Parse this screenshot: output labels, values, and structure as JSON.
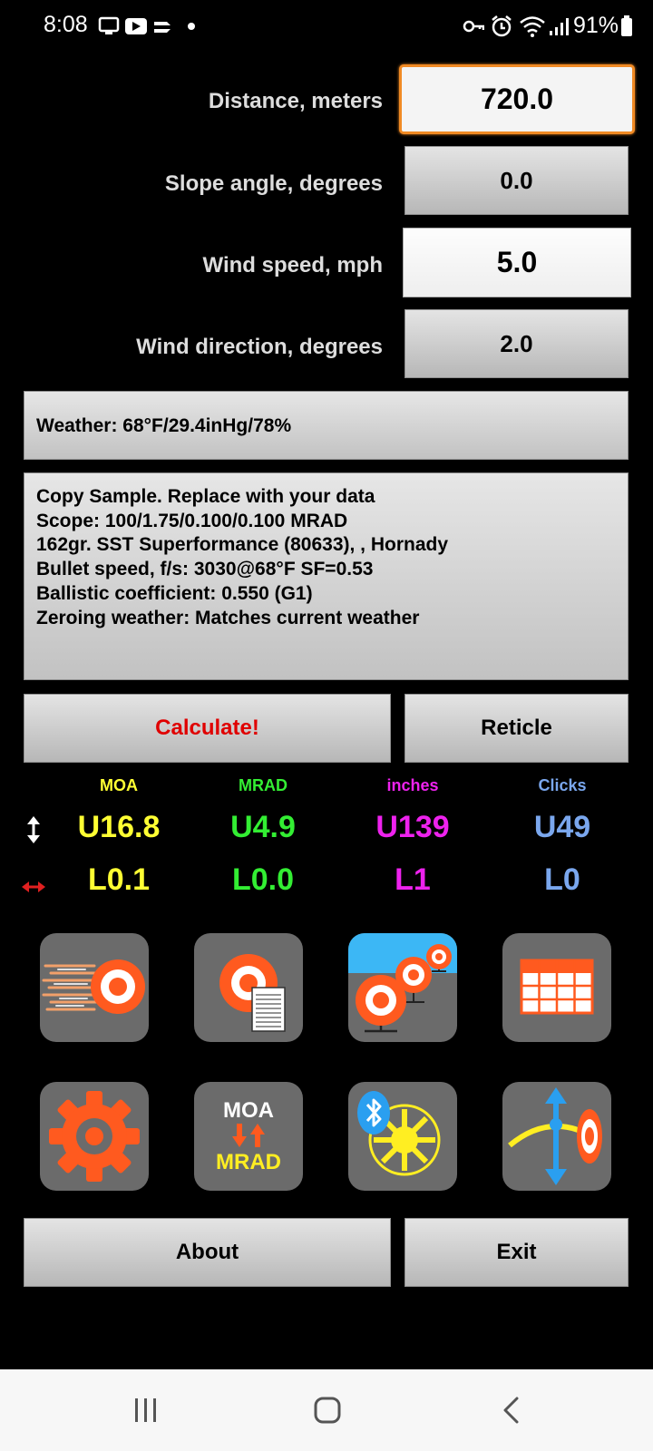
{
  "status_bar": {
    "time": "8:08",
    "battery": "91%"
  },
  "inputs": {
    "distance_label": "Distance, meters",
    "distance_value": "720.0",
    "slope_label": "Slope angle, degrees",
    "slope_value": "0.0",
    "wind_speed_label": "Wind speed, mph",
    "wind_speed_value": "5.0",
    "wind_direction_label": "Wind direction, degrees",
    "wind_direction_value": "2.0"
  },
  "weather": "Weather: 68°F/29.4inHg/78%",
  "profile_lines": [
    "Copy Sample. Replace with your data",
    "Scope: 100/1.75/0.100/0.100 MRAD",
    "162gr. SST Superformance (80633), , Hornady",
    "Bullet speed, f/s: 3030@68°F SF=0.53",
    "Ballistic coefficient: 0.550 (G1)",
    "Zeroing weather: Matches current weather"
  ],
  "buttons": {
    "calculate": "Calculate!",
    "reticle": "Reticle",
    "about": "About",
    "exit": "Exit"
  },
  "results": {
    "headers": [
      "MOA",
      "MRAD",
      "inches",
      "Clicks"
    ],
    "vertical": [
      "U16.8",
      "U4.9",
      "U139",
      "U49"
    ],
    "horizontal": [
      "L0.1",
      "L0.0",
      "L1",
      "L0"
    ]
  },
  "tiles": {
    "moa_label": "MOA",
    "mrad_label": "MRAD"
  },
  "colors": {
    "moa": "#ffff33",
    "mrad": "#33ee33",
    "inches": "#ee22ee",
    "clicks": "#7aa7ee",
    "calculate_text": "#e00000",
    "focus_border": "#f08a24"
  },
  "icons": {
    "vertical_indicator": "vertical-arrows-icon",
    "horizontal_indicator": "horizontal-arrows-icon"
  }
}
